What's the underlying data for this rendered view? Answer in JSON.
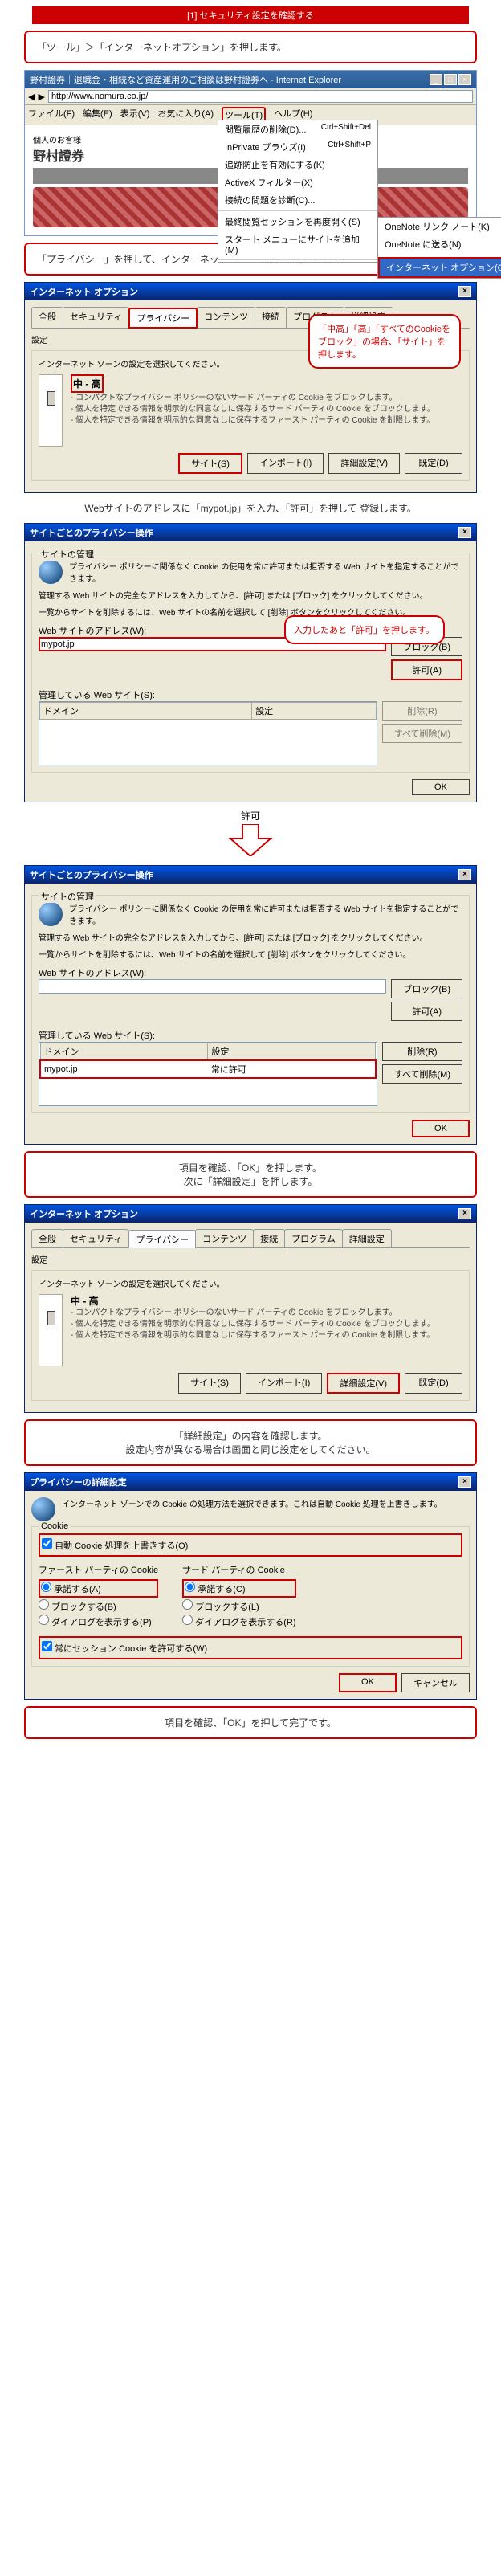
{
  "section_title": "[1] セキュリティ設定を確認する",
  "step1_text": "「ツール」＞「インターネットオプション」を押します。",
  "ie": {
    "title": "野村證券｜退職金・相続など資産運用のご相談は野村證券へ - Internet Explorer",
    "url": "http://www.nomura.co.jp/",
    "menubar": [
      "ファイル(F)",
      "編集(E)",
      "表示(V)",
      "お気に入り(A)",
      "ツール(T)",
      "ヘルプ(H)"
    ],
    "tools_menu": [
      {
        "label": "閲覧履歴の削除(D)...",
        "shortcut": "Ctrl+Shift+Del"
      },
      {
        "label": "InPrivate ブラウズ(I)",
        "shortcut": "Ctrl+Shift+P"
      },
      {
        "label": "追跡防止を有効にする(K)",
        "shortcut": ""
      },
      {
        "label": "ActiveX フィルター(X)",
        "shortcut": ""
      },
      {
        "label": "接続の問題を診断(C)...",
        "shortcut": ""
      },
      {
        "label": "最終閲覧セッションを再度開く(S)",
        "shortcut": ""
      },
      {
        "label": "スタート メニューにサイトを追加(M)",
        "shortcut": ""
      }
    ],
    "submenu": [
      "OneNote リンク ノート(K)",
      "OneNote に送る(N)"
    ],
    "submenu_highlight": "インターネット オプション(O)",
    "page_banner_small": "個人のお客様",
    "page_banner": "野村證券"
  },
  "step2_text": "「プライバシー」を押して、インターネットゾーンの設定を確認します。",
  "options_dialog": {
    "title": "インターネット オプション",
    "tabs": [
      "全般",
      "セキュリティ",
      "プライバシー",
      "コンテンツ",
      "接続",
      "プログラム",
      "詳細設定"
    ],
    "settings_label": "設定",
    "zone_text": "インターネット ゾーンの設定を選択してください。",
    "level_label": "中 - 高",
    "level_desc1": "- コンパクトなプライバシー ポリシーのないサード パーティの Cookie をブロックします。",
    "level_desc2": "- 個人を特定できる情報を明示的な同意なしに保存するサード パーティの Cookie をブロックします。",
    "level_desc3": "- 個人を特定できる情報を明示的な同意なしに保存するファースト パーティの Cookie を制限します。",
    "btn_sites": "サイト(S)",
    "btn_import": "インポート(I)",
    "btn_advanced": "詳細設定(V)",
    "btn_default": "既定(D)"
  },
  "callout1": "「中高」「高」「すべてのCookieをブロック」の場合、「サイト」を押します。",
  "step3_text": "Webサイトのアドレスに「mypot.jp」を入力、「許可」を押して 登録します。",
  "persite_dialog": {
    "title": "サイトごとのプライバシー操作",
    "mgmt_label": "サイトの管理",
    "desc1": "プライバシー ポリシーに関係なく Cookie の使用を常に許可または拒否する Web サイトを指定することができます。",
    "desc2": "管理する Web サイトの完全なアドレスを入力してから、[許可] または [ブロック] をクリックしてください。",
    "desc3": "一覧からサイトを削除するには、Web サイトの名前を選択して [削除] ボタンをクリックしてください。",
    "addr_label": "Web サイトのアドレス(W):",
    "addr_value": "mypot.jp",
    "btn_block": "ブロック(B)",
    "btn_allow": "許可(A)",
    "managed_label": "管理している Web サイト(S):",
    "col_domain": "ドメイン",
    "col_setting": "設定",
    "btn_remove": "削除(R)",
    "btn_removeall": "すべて削除(M)",
    "btn_ok": "OK"
  },
  "callout2": "入力したあと「許可」を押します。",
  "arrow_label": "許可",
  "persite_after": {
    "row_domain": "mypot.jp",
    "row_setting": "常に許可"
  },
  "step4_line1": "項目を確認、「OK」を押します。",
  "step4_line2": "次に「詳細設定」を押します。",
  "step5_line1": "「詳細設定」の内容を確認します。",
  "step5_line2": "設定内容が異なる場合は画面と同じ設定をしてください。",
  "advanced_dialog": {
    "title": "プライバシーの詳細設定",
    "desc": "インターネット ゾーンでの Cookie の処理方法を選択できます。これは自動 Cookie 処理を上書きします。",
    "cookie_label": "Cookie",
    "override_check": "自動 Cookie 処理を上書きする(O)",
    "first_party": "ファースト パーティの Cookie",
    "third_party": "サード パーティの Cookie",
    "opt_accept": "承諾する(A)",
    "opt_block": "ブロックする(B)",
    "opt_prompt": "ダイアログを表示する(P)",
    "opt_accept_c": "承諾する(C)",
    "opt_block_l": "ブロックする(L)",
    "opt_prompt_r": "ダイアログを表示する(R)",
    "session_check": "常にセッション Cookie を許可する(W)",
    "btn_ok": "OK",
    "btn_cancel": "キャンセル"
  },
  "step6_text": "項目を確認、「OK」を押して完了です。"
}
